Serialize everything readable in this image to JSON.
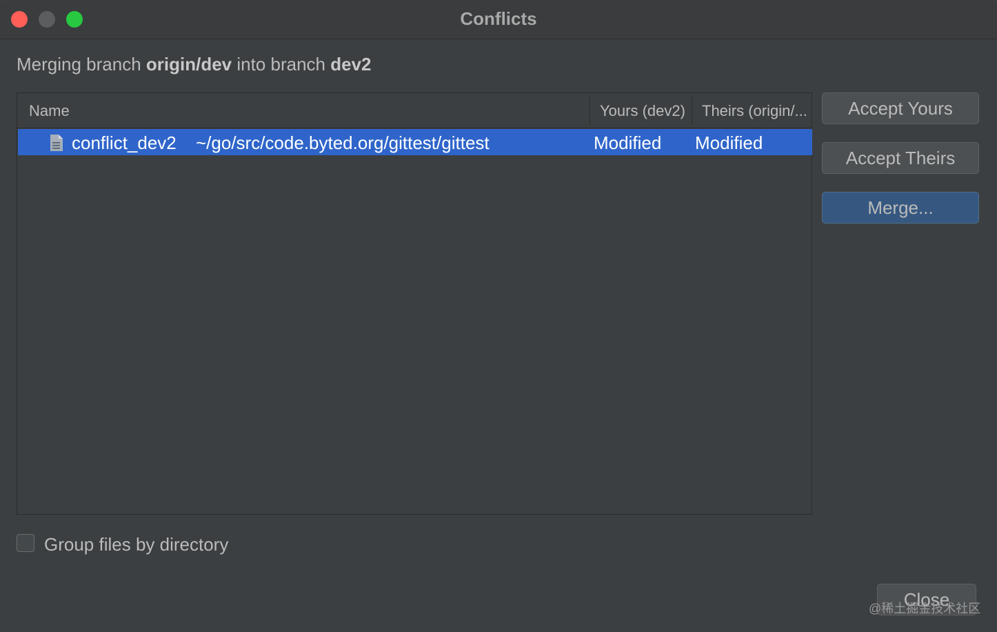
{
  "window": {
    "title": "Conflicts"
  },
  "header": {
    "prefix": "Merging branch ",
    "source_branch": "origin/dev",
    "middle": " into branch ",
    "target_branch": "dev2"
  },
  "table": {
    "columns": {
      "name": "Name",
      "yours": "Yours (dev2)",
      "theirs": "Theirs (origin/..."
    },
    "rows": [
      {
        "file_name": "conflict_dev2",
        "path": "~/go/src/code.byted.org/gittest/gittest",
        "yours": "Modified",
        "theirs": "Modified",
        "icon": "text-file-icon"
      }
    ]
  },
  "buttons": {
    "accept_yours": "Accept Yours",
    "accept_theirs": "Accept Theirs",
    "merge": "Merge...",
    "close": "Close"
  },
  "options": {
    "group_by_directory": "Group files by directory",
    "group_by_directory_checked": false
  },
  "watermark": "@稀土掘金技术社区",
  "colors": {
    "background": "#3c3f41",
    "selection": "#2f65ca",
    "default_button": "#365880",
    "traffic_close": "#ff5f57",
    "traffic_max": "#28c840"
  }
}
